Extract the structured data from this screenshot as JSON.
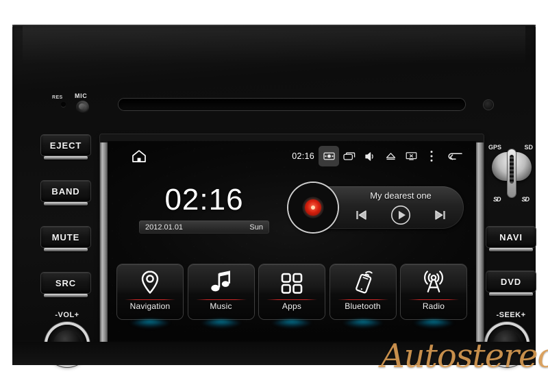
{
  "device": {
    "watermark": "Autostereo",
    "labels": {
      "res": "RES",
      "mic": "MIC",
      "gps": "GPS",
      "sd": "SD",
      "sd_mark_left": "SD",
      "sd_mark_right": "SD",
      "volume": "-VOL+",
      "seek": "-SEEK+"
    },
    "left_buttons": [
      {
        "id": "eject",
        "label": "EJECT"
      },
      {
        "id": "band",
        "label": "BAND"
      },
      {
        "id": "mute",
        "label": "MUTE"
      },
      {
        "id": "src",
        "label": "SRC"
      }
    ],
    "right_buttons": [
      {
        "id": "navi",
        "label": "NAVI"
      },
      {
        "id": "dvd",
        "label": "DVD"
      }
    ],
    "knobs": [
      {
        "id": "volume-knob",
        "label": "-VOL+"
      },
      {
        "id": "seek-knob",
        "label": "-SEEK+"
      }
    ],
    "disc_slot": "disc-slot"
  },
  "screen": {
    "statusbar": {
      "home_icon": "home-icon",
      "clock": "02:16",
      "icons": [
        {
          "name": "screenshot-icon",
          "highlighted": true
        },
        {
          "name": "recent-apps-icon",
          "highlighted": false
        },
        {
          "name": "volume-icon",
          "highlighted": false
        },
        {
          "name": "eject-icon",
          "highlighted": false
        },
        {
          "name": "screen-off-icon",
          "highlighted": false
        },
        {
          "name": "overflow-menu-icon",
          "highlighted": false
        },
        {
          "name": "back-icon",
          "highlighted": false
        }
      ]
    },
    "clock_widget": {
      "time": "02:16",
      "date": "2012.01.01",
      "weekday": "Sun"
    },
    "player_widget": {
      "track_title": "My dearest one",
      "album_art": "vinyl-record",
      "controls": [
        {
          "name": "previous-track-button",
          "glyph": "prev"
        },
        {
          "name": "play-button",
          "glyph": "play"
        },
        {
          "name": "next-track-button",
          "glyph": "next"
        }
      ]
    },
    "app_tiles": [
      {
        "id": "navigation",
        "label": "Navigation",
        "icon": "map-pin-icon"
      },
      {
        "id": "music",
        "label": "Music",
        "icon": "music-note-icon"
      },
      {
        "id": "apps",
        "label": "Apps",
        "icon": "grid-icon"
      },
      {
        "id": "bluetooth",
        "label": "Bluetooth",
        "icon": "phone-signal-icon"
      },
      {
        "id": "radio",
        "label": "Radio",
        "icon": "radio-tower-icon"
      }
    ]
  },
  "colors": {
    "accent_cyan": "#00bee8",
    "tile_divider_red": "#d72828",
    "watermark": "#d79a52",
    "record_red": "#d41f0d",
    "chassis": "#0d0d0d"
  }
}
